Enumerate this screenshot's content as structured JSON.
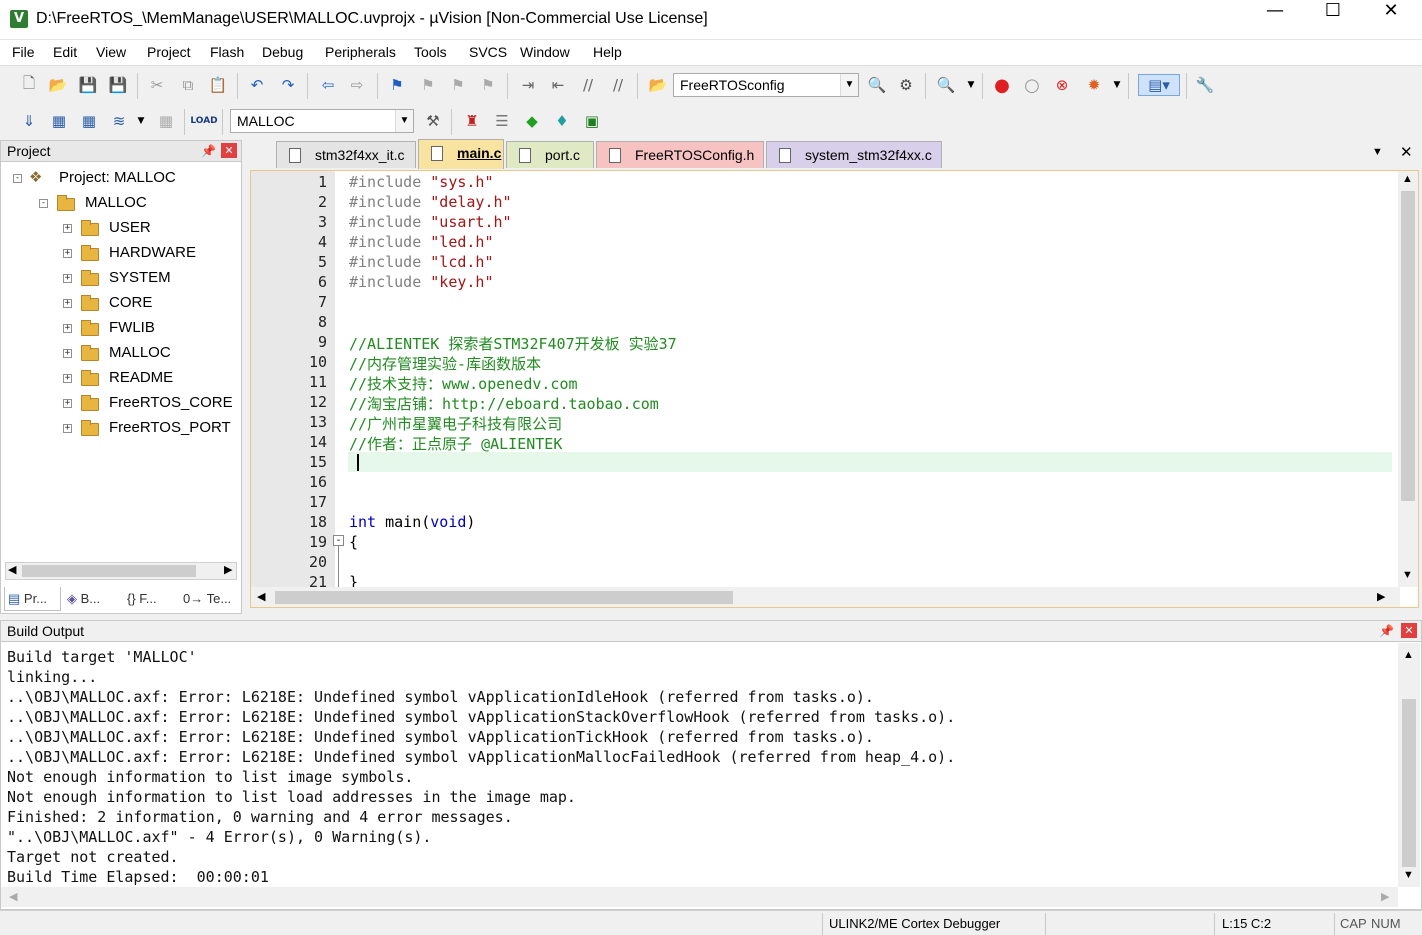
{
  "window": {
    "title": "D:\\FreeRTOS_\\MemManage\\USER\\MALLOC.uvprojx - µVision  [Non-Commercial Use License]",
    "app_icon": "µVision",
    "min": "—",
    "max": "☐",
    "close": "✕"
  },
  "menu": [
    "File",
    "Edit",
    "View",
    "Project",
    "Flash",
    "Debug",
    "Peripherals",
    "Tools",
    "SVCS",
    "Window",
    "Help"
  ],
  "toolbar1": {
    "target_combo": "FreeRTOSconfig"
  },
  "toolbar2": {
    "target_select": "MALLOC"
  },
  "project_panel": {
    "title": "Project",
    "root": "Project: MALLOC",
    "target": "MALLOC",
    "groups": [
      "USER",
      "HARDWARE",
      "SYSTEM",
      "CORE",
      "FWLIB",
      "MALLOC",
      "README",
      "FreeRTOS_CORE",
      "FreeRTOS_PORT"
    ],
    "tabs": [
      "Pr...",
      "B...",
      "{} F...",
      "0→ Te..."
    ]
  },
  "editor": {
    "tabs": [
      {
        "label": "stm32f4xx_it.c",
        "color": "#e4e4e4"
      },
      {
        "label": "main.c",
        "color": "#f9e3a1"
      },
      {
        "label": "port.c",
        "color": "#dfe9c4"
      },
      {
        "label": "FreeRTOSConfig.h",
        "color": "#f6c2c2"
      },
      {
        "label": "system_stm32f4xx.c",
        "color": "#d8cfea"
      }
    ],
    "active_tab": "main.c",
    "lines": [
      {
        "n": "1",
        "segs": [
          [
            "pp",
            "#include "
          ],
          [
            "str",
            "\"sys.h\""
          ]
        ]
      },
      {
        "n": "2",
        "segs": [
          [
            "pp",
            "#include "
          ],
          [
            "str",
            "\"delay.h\""
          ]
        ]
      },
      {
        "n": "3",
        "segs": [
          [
            "pp",
            "#include "
          ],
          [
            "str",
            "\"usart.h\""
          ]
        ]
      },
      {
        "n": "4",
        "segs": [
          [
            "pp",
            "#include "
          ],
          [
            "str",
            "\"led.h\""
          ]
        ]
      },
      {
        "n": "5",
        "segs": [
          [
            "pp",
            "#include "
          ],
          [
            "str",
            "\"lcd.h\""
          ]
        ]
      },
      {
        "n": "6",
        "segs": [
          [
            "pp",
            "#include "
          ],
          [
            "str",
            "\"key.h\""
          ]
        ]
      },
      {
        "n": "7",
        "segs": []
      },
      {
        "n": "8",
        "segs": []
      },
      {
        "n": "9",
        "segs": [
          [
            "cm",
            "//ALIENTEK 探索者STM32F407开发板 实验37"
          ]
        ]
      },
      {
        "n": "10",
        "segs": [
          [
            "cm",
            "//内存管理实验-库函数版本"
          ]
        ]
      },
      {
        "n": "11",
        "segs": [
          [
            "cm",
            "//技术支持：www.openedv.com"
          ]
        ]
      },
      {
        "n": "12",
        "segs": [
          [
            "cm",
            "//淘宝店铺：http://eboard.taobao.com"
          ]
        ]
      },
      {
        "n": "13",
        "segs": [
          [
            "cm",
            "//广州市星翼电子科技有限公司"
          ]
        ]
      },
      {
        "n": "14",
        "segs": [
          [
            "cm",
            "//作者：正点原子 @ALIENTEK"
          ]
        ]
      },
      {
        "n": "15",
        "segs": []
      },
      {
        "n": "16",
        "segs": []
      },
      {
        "n": "17",
        "segs": []
      },
      {
        "n": "18",
        "segs": [
          [
            "kw",
            "int"
          ],
          [
            "tx",
            " main("
          ],
          [
            "kw",
            "void"
          ],
          [
            "tx",
            ")"
          ]
        ]
      },
      {
        "n": "19",
        "segs": [
          [
            "tx",
            "{"
          ]
        ]
      },
      {
        "n": "20",
        "segs": []
      },
      {
        "n": "21",
        "segs": [
          [
            "tx",
            "}"
          ]
        ]
      }
    ]
  },
  "build_output": {
    "title": "Build Output",
    "lines": [
      "Build target 'MALLOC'",
      "linking...",
      "..\\OBJ\\MALLOC.axf: Error: L6218E: Undefined symbol vApplicationIdleHook (referred from tasks.o).",
      "..\\OBJ\\MALLOC.axf: Error: L6218E: Undefined symbol vApplicationStackOverflowHook (referred from tasks.o).",
      "..\\OBJ\\MALLOC.axf: Error: L6218E: Undefined symbol vApplicationTickHook (referred from tasks.o).",
      "..\\OBJ\\MALLOC.axf: Error: L6218E: Undefined symbol vApplicationMallocFailedHook (referred from heap_4.o).",
      "Not enough information to list image symbols.",
      "Not enough information to list load addresses in the image map.",
      "Finished: 2 information, 0 warning and 4 error messages.",
      "\"..\\OBJ\\MALLOC.axf\" - 4 Error(s), 0 Warning(s).",
      "Target not created.",
      "Build Time Elapsed:  00:00:01"
    ]
  },
  "status": {
    "debugger": "ULINK2/ME Cortex Debugger",
    "position": "L:15 C:2",
    "cap": "CAP",
    "num": "NUM"
  }
}
